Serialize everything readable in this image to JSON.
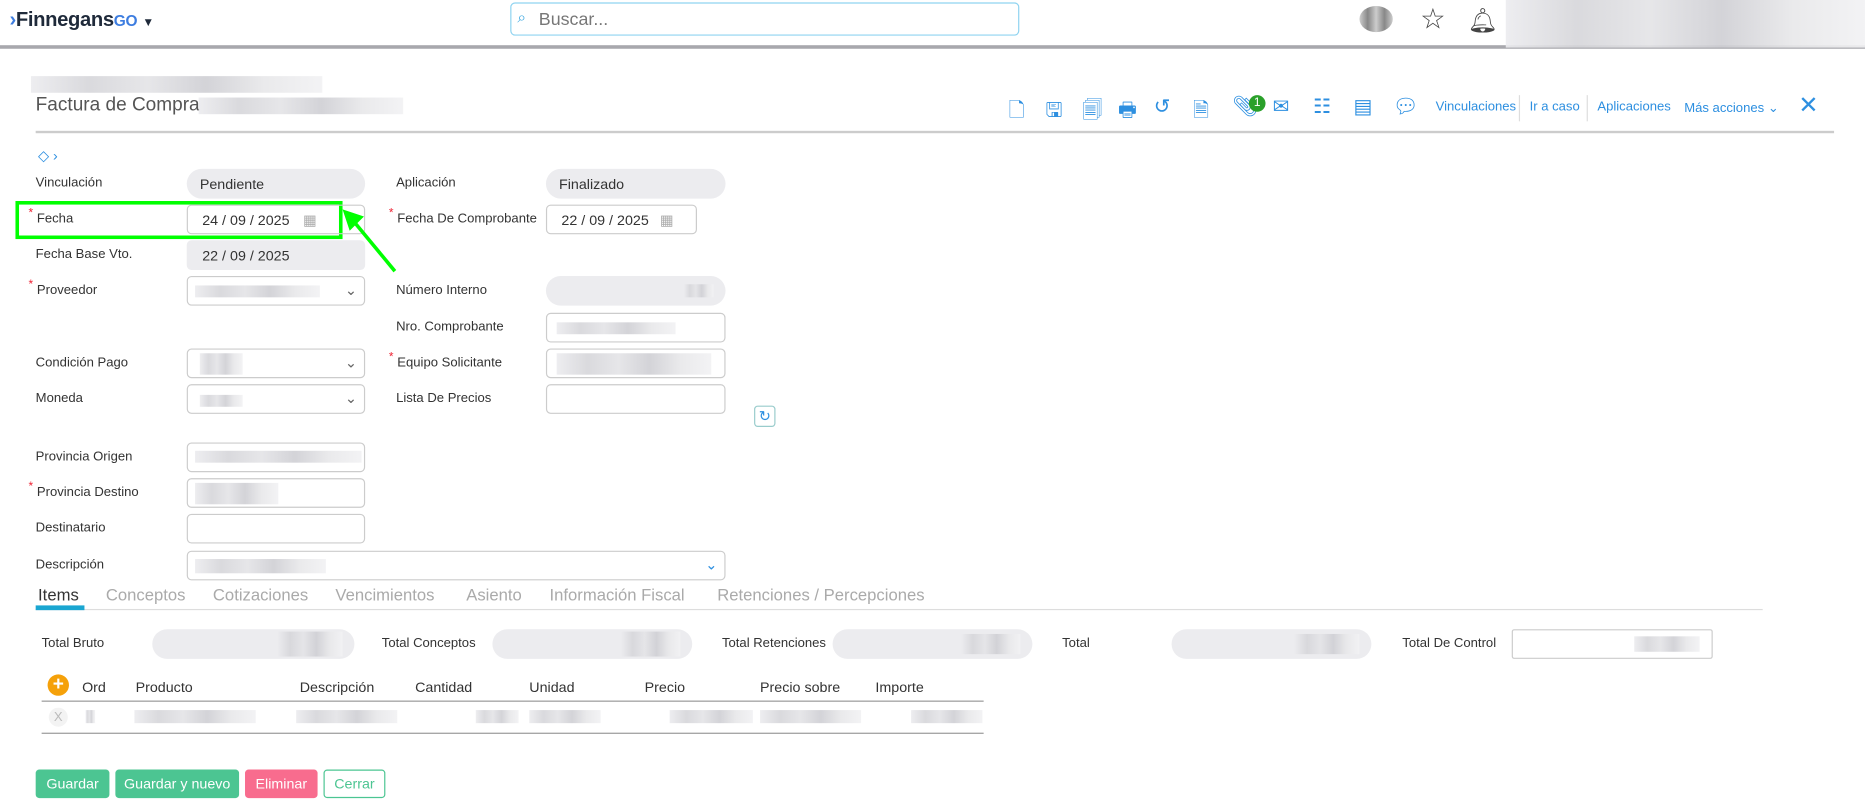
{
  "header": {
    "brand": "Finnegans",
    "brand_suffix": "GO",
    "search_placeholder": "Buscar..."
  },
  "page": {
    "title": "Factura de Compra"
  },
  "toolbar": {
    "links": [
      "Vinculaciones",
      "Ir a caso",
      "Aplicaciones",
      "Más acciones"
    ],
    "attachment_count": "1"
  },
  "form": {
    "vinculacion": {
      "label": "Vinculación",
      "value": "Pendiente"
    },
    "aplicacion": {
      "label": "Aplicación",
      "value": "Finalizado"
    },
    "fecha": {
      "label": "Fecha",
      "day": "24",
      "month": "09",
      "year": "2025"
    },
    "fecha_comprobante": {
      "label": "Fecha De Comprobante",
      "day": "22",
      "month": "09",
      "year": "2025"
    },
    "fecha_base": {
      "label": "Fecha Base Vto.",
      "day": "22",
      "month": "09",
      "year": "2025"
    },
    "proveedor": {
      "label": "Proveedor"
    },
    "numero_interno": {
      "label": "Número Interno"
    },
    "nro_comprobante": {
      "label": "Nro. Comprobante"
    },
    "condicion_pago": {
      "label": "Condición Pago"
    },
    "equipo": {
      "label": "Equipo Solicitante"
    },
    "moneda": {
      "label": "Moneda"
    },
    "lista_precios": {
      "label": "Lista De Precios"
    },
    "provincia_origen": {
      "label": "Provincia Origen"
    },
    "provincia_destino": {
      "label": "Provincia Destino"
    },
    "destinatario": {
      "label": "Destinatario"
    },
    "descripcion": {
      "label": "Descripción"
    }
  },
  "tabs": [
    "Items",
    "Conceptos",
    "Cotizaciones",
    "Vencimientos",
    "Asiento",
    "Información Fiscal",
    "Retenciones / Percepciones"
  ],
  "totals": [
    "Total Bruto",
    "Total Conceptos",
    "Total Retenciones",
    "Total",
    "Total De Control"
  ],
  "table": {
    "headers": [
      "Ord",
      "Producto",
      "Descripción",
      "Cantidad",
      "Unidad",
      "Precio",
      "Precio sobre",
      "Importe"
    ],
    "delete_label": "X"
  },
  "buttons": {
    "save": "Guardar",
    "save_new": "Guardar y nuevo",
    "delete": "Eliminar",
    "close": "Cerrar"
  },
  "colors": {
    "accent": "#2d8fe0",
    "highlight": "#00ff00",
    "save": "#4cc592",
    "delete": "#f86c8e"
  }
}
